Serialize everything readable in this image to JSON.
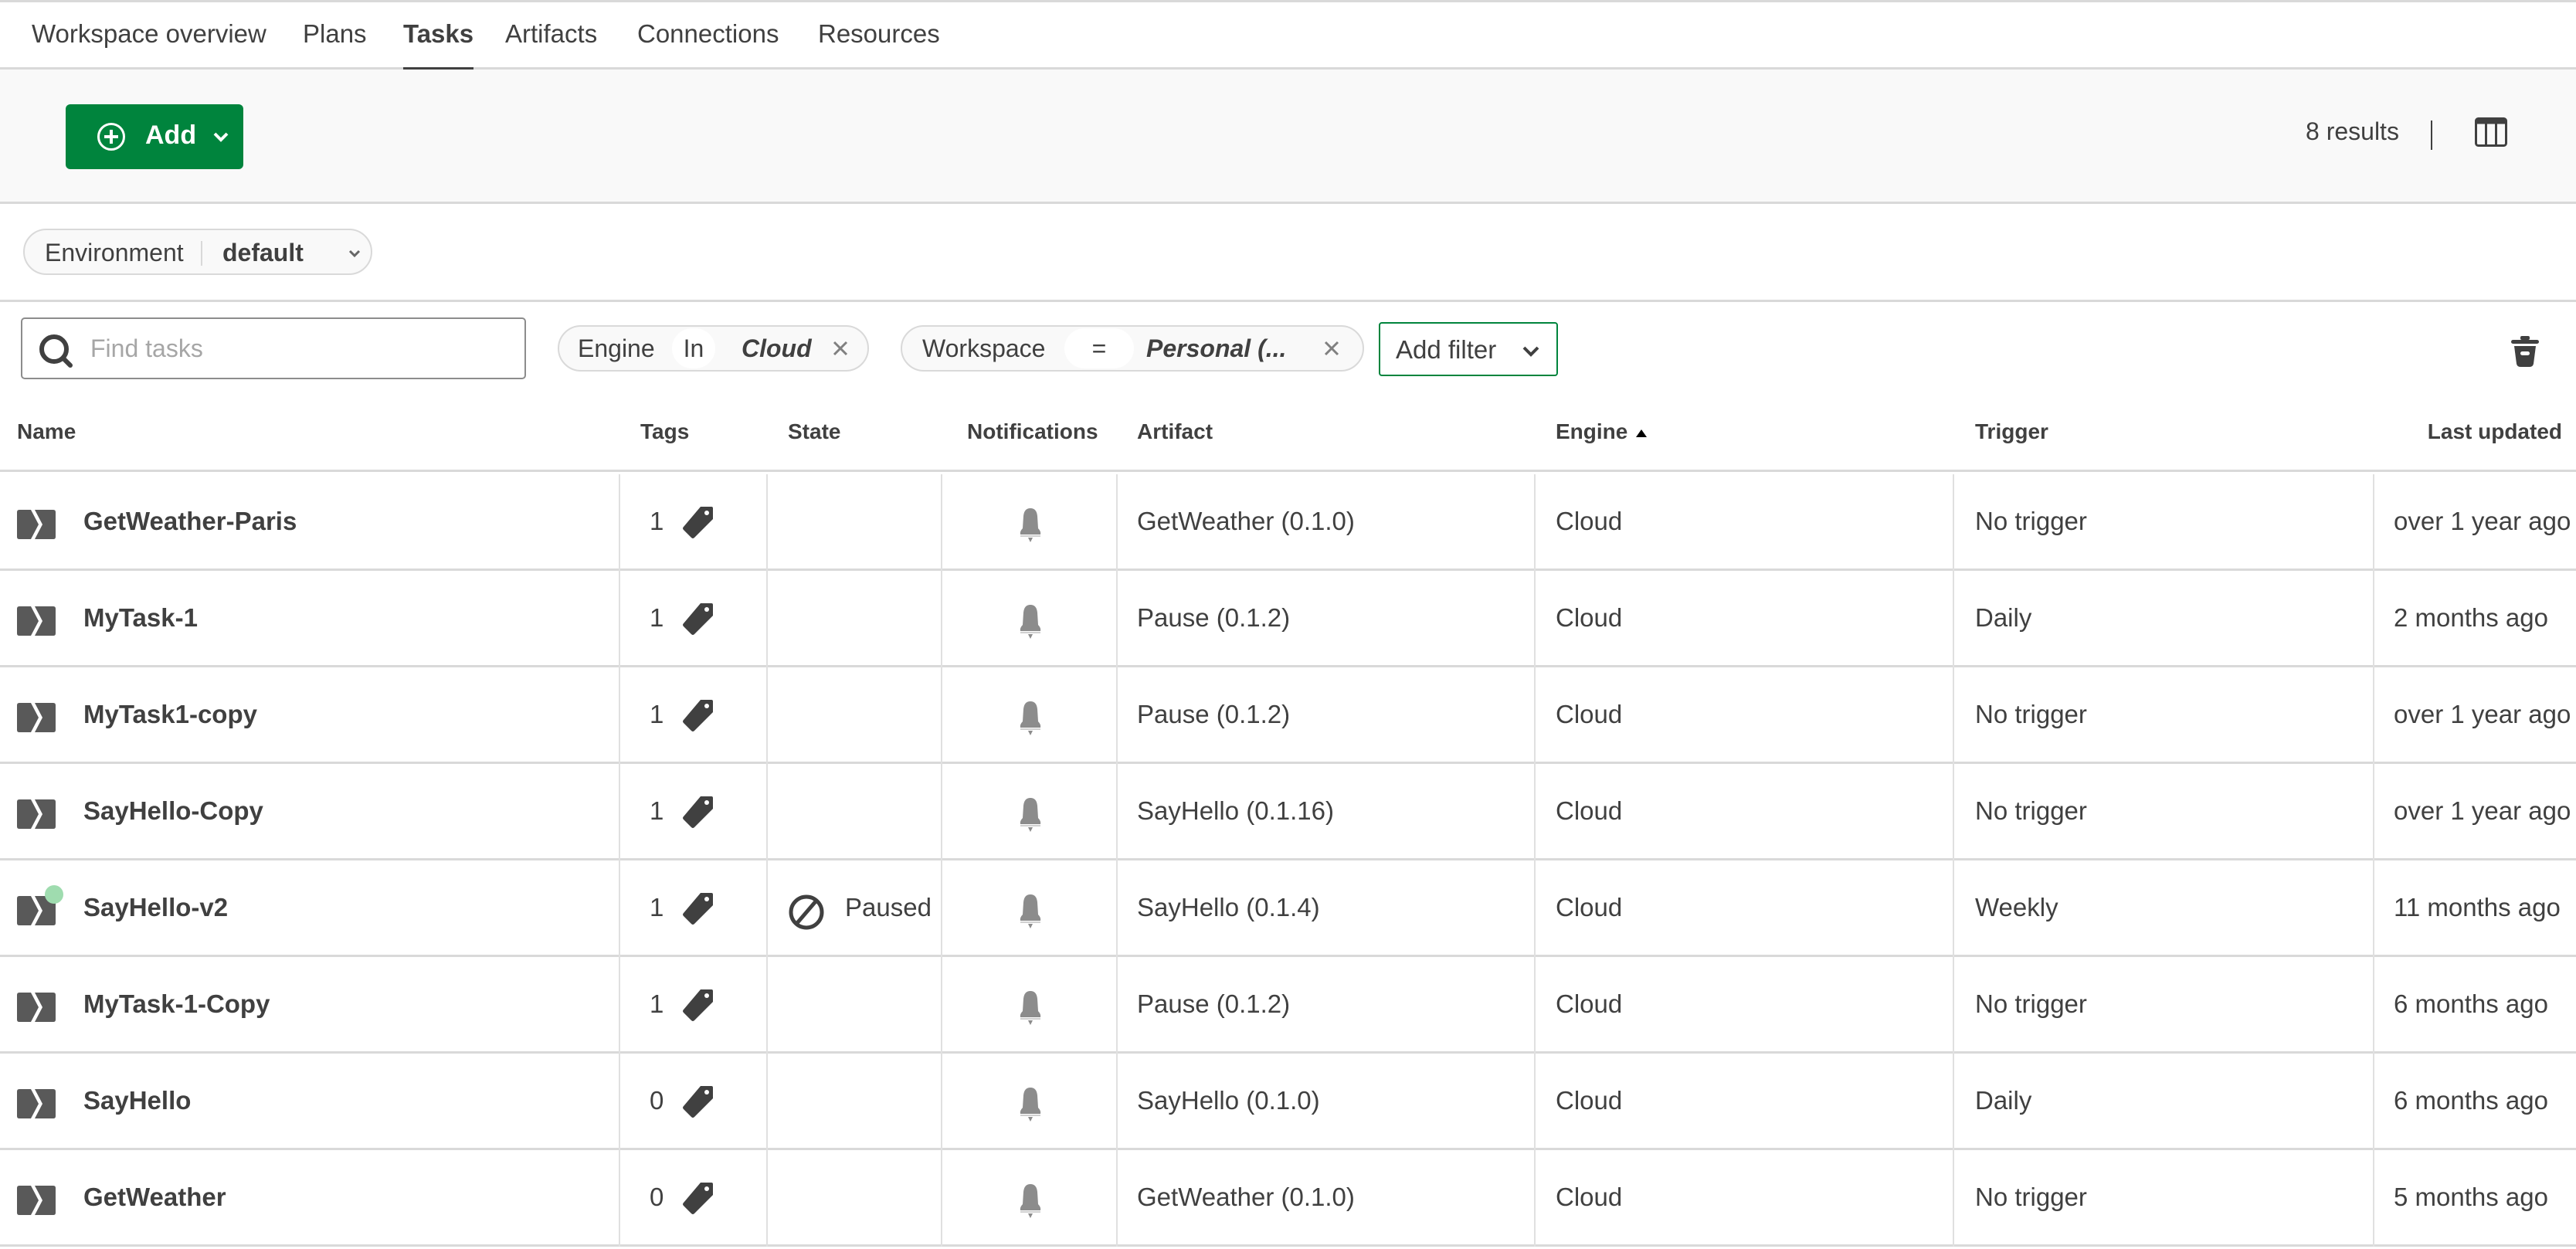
{
  "nav": {
    "tabs": [
      {
        "label": "Workspace overview",
        "active": false
      },
      {
        "label": "Plans",
        "active": false
      },
      {
        "label": "Tasks",
        "active": true
      },
      {
        "label": "Artifacts",
        "active": false
      },
      {
        "label": "Connections",
        "active": false
      },
      {
        "label": "Resources",
        "active": false
      }
    ]
  },
  "toolbar": {
    "add_label": "Add",
    "results_text": "8 results",
    "accent_color": "#00843d"
  },
  "environment": {
    "label": "Environment",
    "value": "default"
  },
  "filters": {
    "search_placeholder": "Find tasks",
    "search_value": "",
    "chips": [
      {
        "field": "Engine",
        "operator": "In",
        "value": "Cloud"
      },
      {
        "field": "Workspace",
        "operator": "=",
        "value": "Personal (..."
      }
    ],
    "add_filter_label": "Add filter"
  },
  "table": {
    "columns": [
      "Name",
      "Tags",
      "State",
      "Notifications",
      "Artifact",
      "Engine",
      "Trigger",
      "Last updated"
    ],
    "sorted_column": "Engine",
    "sort_direction": "ascending",
    "rows": [
      {
        "name": "GetWeather-Paris",
        "tags": "1",
        "state": "",
        "artifact": "GetWeather (0.1.0)",
        "engine": "Cloud",
        "trigger": "No trigger",
        "last_updated": "over 1 year ago"
      },
      {
        "name": "MyTask-1",
        "tags": "1",
        "state": "",
        "artifact": "Pause (0.1.2)",
        "engine": "Cloud",
        "trigger": "Daily",
        "last_updated": "2 months ago"
      },
      {
        "name": "MyTask1-copy",
        "tags": "1",
        "state": "",
        "artifact": "Pause (0.1.2)",
        "engine": "Cloud",
        "trigger": "No trigger",
        "last_updated": "over 1 year ago"
      },
      {
        "name": "SayHello-Copy",
        "tags": "1",
        "state": "",
        "artifact": "SayHello (0.1.16)",
        "engine": "Cloud",
        "trigger": "No trigger",
        "last_updated": "over 1 year ago"
      },
      {
        "name": "SayHello-v2",
        "tags": "1",
        "state": "Paused",
        "status_dot_color": "#9fdcaf",
        "artifact": "SayHello (0.1.4)",
        "engine": "Cloud",
        "trigger": "Weekly",
        "last_updated": "11 months ago"
      },
      {
        "name": "MyTask-1-Copy",
        "tags": "1",
        "state": "",
        "artifact": "Pause (0.1.2)",
        "engine": "Cloud",
        "trigger": "No trigger",
        "last_updated": "6 months ago"
      },
      {
        "name": "SayHello",
        "tags": "0",
        "state": "",
        "artifact": "SayHello (0.1.0)",
        "engine": "Cloud",
        "trigger": "Daily",
        "last_updated": "6 months ago"
      },
      {
        "name": "GetWeather",
        "tags": "0",
        "state": "",
        "artifact": "GetWeather (0.1.0)",
        "engine": "Cloud",
        "trigger": "No trigger",
        "last_updated": "5 months ago"
      }
    ]
  },
  "icons": {
    "add": "plus-circle-icon",
    "columns": "columns-icon",
    "search": "search-icon",
    "trash": "trash-icon",
    "task": "task-icon",
    "tag": "tag-icon",
    "paused": "paused-icon",
    "notification": "bell-icon",
    "sort": "sort-ascending-icon"
  }
}
